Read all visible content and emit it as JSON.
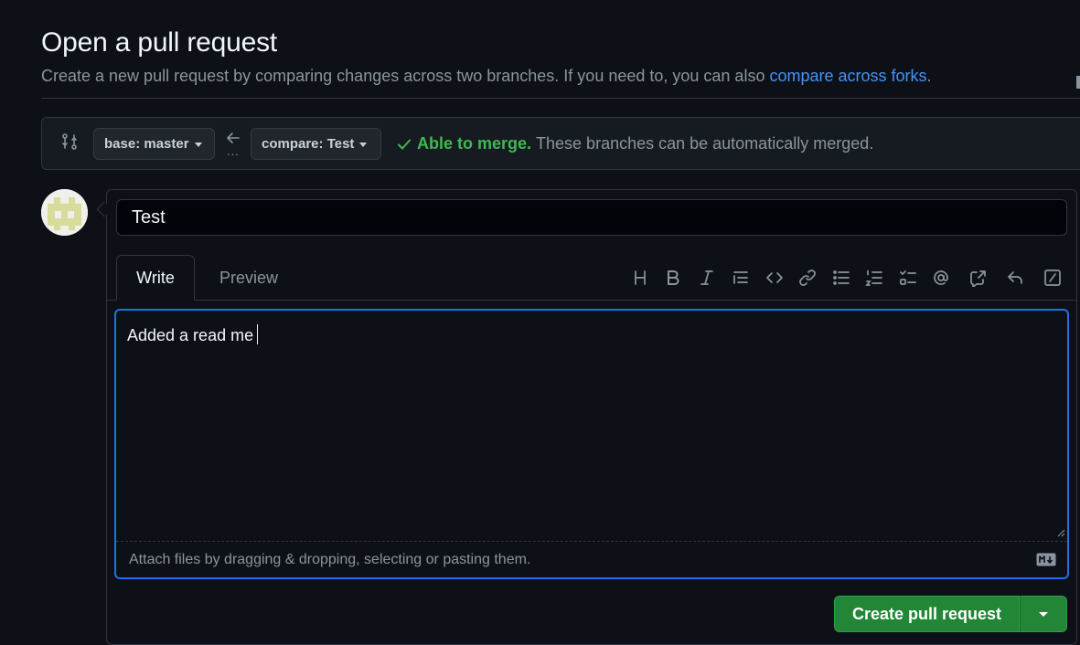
{
  "header": {
    "title": "Open a pull request",
    "subtitle_text": "Create a new pull request by comparing changes across two branches. If you need to, you can also ",
    "subtitle_link": "compare across forks",
    "subtitle_end": "."
  },
  "compare": {
    "base_label": "base: master",
    "compare_label": "compare: Test",
    "ellipsis": "...",
    "merge_ok": "Able to merge.",
    "merge_detail": "These branches can be automatically merged."
  },
  "form": {
    "title_value": "Test",
    "tabs": [
      {
        "label": "Write",
        "selected": true
      },
      {
        "label": "Preview",
        "selected": false
      }
    ],
    "toolbar": [
      "heading-icon",
      "bold-icon",
      "italic-icon",
      "quote-icon",
      "code-icon",
      "link-icon",
      "unordered-list-icon",
      "ordered-list-icon",
      "task-list-icon",
      "mention-icon",
      "cross-reference-icon",
      "saved-reply-icon",
      "slash-commands-icon"
    ],
    "body_value": "Added a read me",
    "attach_hint": "Attach files by dragging & dropping, selecting or pasting them.",
    "submit_label": "Create pull request"
  },
  "colors": {
    "background": "#0d1117",
    "accent_blue": "#1f6feb",
    "link_blue": "#4493f8",
    "success_green": "#3fb950",
    "button_green": "#238636"
  }
}
